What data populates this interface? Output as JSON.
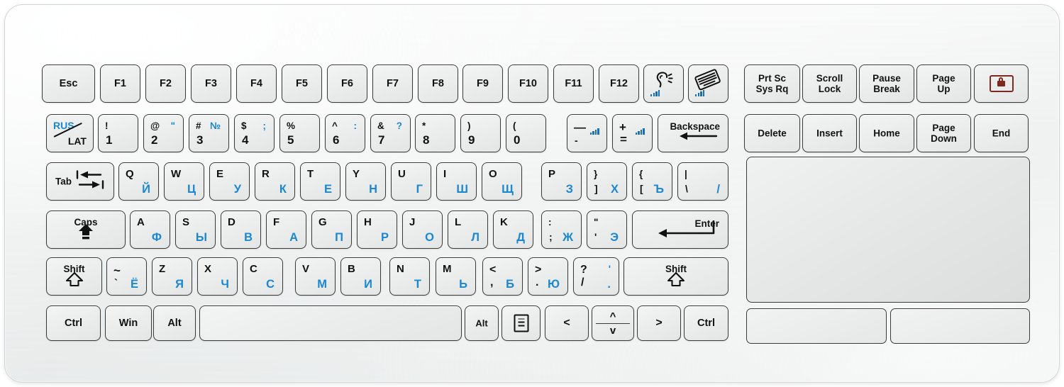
{
  "device": {
    "name": "industrial-membrane-keyboard-with-touchpad",
    "layout": "RUS / LAT bilingual",
    "colors": {
      "chassis": "#f2f3f3",
      "keycap": "#ecedee",
      "key_border": "#3a3a3a",
      "latin_legend": "#111111",
      "cyrillic_legend": "#1b87d2",
      "lock_icon": "#7d2b20"
    }
  },
  "function_row": {
    "keys": [
      {
        "label": "Esc"
      },
      {
        "label": "F1"
      },
      {
        "label": "F2"
      },
      {
        "label": "F3"
      },
      {
        "label": "F4"
      },
      {
        "label": "F5"
      },
      {
        "label": "F6"
      },
      {
        "label": "F7"
      },
      {
        "label": "F8"
      },
      {
        "label": "F9"
      },
      {
        "label": "F10"
      },
      {
        "label": "F11"
      },
      {
        "label": "F12"
      }
    ],
    "icon_keys": [
      {
        "icon": "ear-hearing-icon",
        "badge": "signal-bars-icon"
      },
      {
        "icon": "keyboard-icon",
        "badge": "signal-bars-icon"
      }
    ]
  },
  "number_row": {
    "lang_key": {
      "top": "RUS",
      "bottom": "LAT"
    },
    "keys": [
      {
        "shift": "!",
        "shift_alt": "",
        "base": "1",
        "base_alt": ""
      },
      {
        "shift": "@",
        "shift_alt": "\"",
        "base": "2",
        "base_alt": ""
      },
      {
        "shift": "#",
        "shift_alt": "№",
        "base": "3",
        "base_alt": ""
      },
      {
        "shift": "$",
        "shift_alt": ";",
        "base": "4",
        "base_alt": ""
      },
      {
        "shift": "%",
        "shift_alt": "",
        "base": "5",
        "base_alt": ""
      },
      {
        "shift": "^",
        "shift_alt": ":",
        "base": "6",
        "base_alt": ""
      },
      {
        "shift": "&",
        "shift_alt": "?",
        "base": "7",
        "base_alt": ""
      },
      {
        "shift": "*",
        "shift_alt": "",
        "base": "8",
        "base_alt": ""
      },
      {
        "shift": ")",
        "shift_alt": "",
        "base": "9",
        "base_alt": ""
      },
      {
        "shift": "(",
        "shift_alt": "",
        "base": "0",
        "base_alt": ""
      }
    ],
    "minus_key": {
      "shift": "—",
      "base": "-",
      "badge": "volume-down-icon"
    },
    "plus_key": {
      "shift": "+",
      "base": "=",
      "badge": "volume-up-icon"
    },
    "backspace": {
      "label": "Backspace",
      "icon": "arrow-left-icon"
    }
  },
  "tab_row": {
    "tab": {
      "label": "Tab",
      "icon": "tab-arrows-icon"
    },
    "keys": [
      {
        "lat": "Q",
        "cyr": "Й"
      },
      {
        "lat": "W",
        "cyr": "Ц"
      },
      {
        "lat": "E",
        "cyr": "У"
      },
      {
        "lat": "R",
        "cyr": "К"
      },
      {
        "lat": "T",
        "cyr": "Е"
      },
      {
        "lat": "Y",
        "cyr": "Н"
      },
      {
        "lat": "U",
        "cyr": "Г"
      },
      {
        "lat": "I",
        "cyr": "Ш"
      },
      {
        "lat": "O",
        "cyr": "Щ"
      },
      {
        "lat": "P",
        "cyr": "З"
      }
    ],
    "bracket_keys": [
      {
        "shift": "}",
        "base": "]",
        "cyr": "Х"
      },
      {
        "shift": "{",
        "base": "[",
        "cyr": "Ъ"
      },
      {
        "shift": "|",
        "base": "\\",
        "cyr": "/"
      }
    ]
  },
  "home_row": {
    "caps": {
      "label": "Caps",
      "icon": "caps-lock-arrow-icon"
    },
    "keys": [
      {
        "lat": "A",
        "cyr": "Ф"
      },
      {
        "lat": "S",
        "cyr": "Ы"
      },
      {
        "lat": "D",
        "cyr": "В"
      },
      {
        "lat": "F",
        "cyr": "А"
      },
      {
        "lat": "G",
        "cyr": "П"
      },
      {
        "lat": "H",
        "cyr": "Р"
      },
      {
        "lat": "J",
        "cyr": "О"
      },
      {
        "lat": "L",
        "cyr": "Л"
      },
      {
        "lat": "K",
        "cyr": "Д"
      }
    ],
    "punct_keys": [
      {
        "shift": ":",
        "base": ";",
        "cyr": "Ж"
      },
      {
        "shift": "\"",
        "base": "'",
        "cyr": "Э"
      }
    ],
    "enter": {
      "label": "Enter",
      "icon": "enter-arrow-icon"
    }
  },
  "shift_row": {
    "left_shift": {
      "label": "Shift",
      "icon": "shift-arrow-icon"
    },
    "tilde_key": {
      "shift": "~",
      "base": "`",
      "cyr": "Ё"
    },
    "keys": [
      {
        "lat": "Z",
        "cyr": "Я"
      },
      {
        "lat": "X",
        "cyr": "Ч"
      },
      {
        "lat": "C",
        "cyr": "С"
      },
      {
        "lat": "V",
        "cyr": "М"
      },
      {
        "lat": "B",
        "cyr": "И"
      },
      {
        "lat": "N",
        "cyr": "Т"
      },
      {
        "lat": "M",
        "cyr": "Ь"
      }
    ],
    "punct_keys": [
      {
        "shift": "<",
        "base": ",",
        "cyr": "Б",
        "cyr_shift": ""
      },
      {
        "shift": ">",
        "base": ".",
        "cyr": "Ю",
        "cyr_shift": ""
      },
      {
        "shift": "?",
        "base": "/",
        "cyr": ".",
        "cyr_shift": "'"
      }
    ],
    "right_shift": {
      "label": "Shift",
      "icon": "shift-arrow-icon"
    }
  },
  "bottom_row": {
    "left_ctrl": "Ctrl",
    "win": "Win",
    "left_alt": "Alt",
    "space": "",
    "right_alt": "Alt",
    "menu": {
      "icon": "context-menu-icon"
    },
    "arrow_left": "<",
    "arrow_up": "^",
    "arrow_down": "v",
    "arrow_right": ">",
    "right_ctrl": "Ctrl"
  },
  "nav_block": {
    "row1": [
      {
        "label": "Prt Sc\nSys Rq"
      },
      {
        "label": "Scroll\nLock"
      },
      {
        "label": "Pause\nBreak"
      },
      {
        "label": "Page\nUp"
      }
    ],
    "lock_key": {
      "icon": "lock-icon"
    },
    "row2": [
      {
        "label": "Delete"
      },
      {
        "label": "Insert"
      },
      {
        "label": "Home"
      },
      {
        "label": "Page\nDown"
      },
      {
        "label": "End"
      }
    ]
  },
  "pointing_device": {
    "touchpad": {
      "name": "touchpad"
    },
    "left_button": {
      "name": "mouse-left-button"
    },
    "right_button": {
      "name": "mouse-right-button"
    }
  }
}
